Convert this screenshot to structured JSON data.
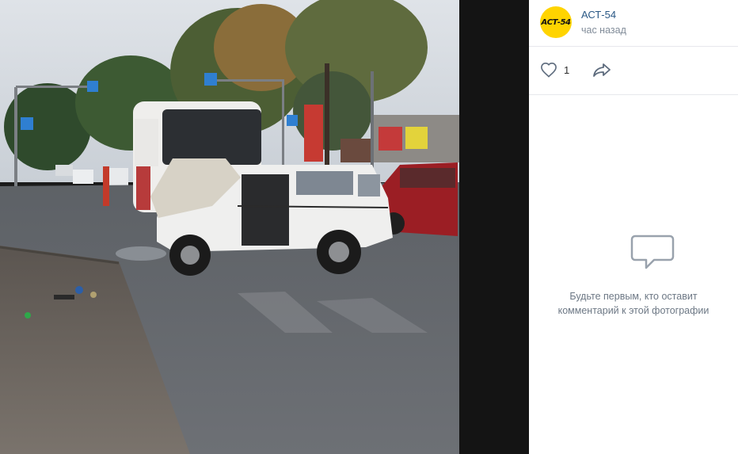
{
  "post": {
    "author": "АСТ-54",
    "time": "час назад",
    "avatar_logo": "АСТ-54",
    "likes": "1",
    "empty_comments_line1": "Будьте первым, кто оставит",
    "empty_comments_line2": "комментарий к этой фотографии"
  },
  "icons": {
    "like": "heart-icon",
    "share": "share-arrow-icon",
    "comment": "comment-bubble-icon"
  },
  "colors": {
    "author_link": "#2a5885",
    "muted": "#818c99",
    "avatar_bg": "#ffd400",
    "viewer_bg": "#000000"
  }
}
